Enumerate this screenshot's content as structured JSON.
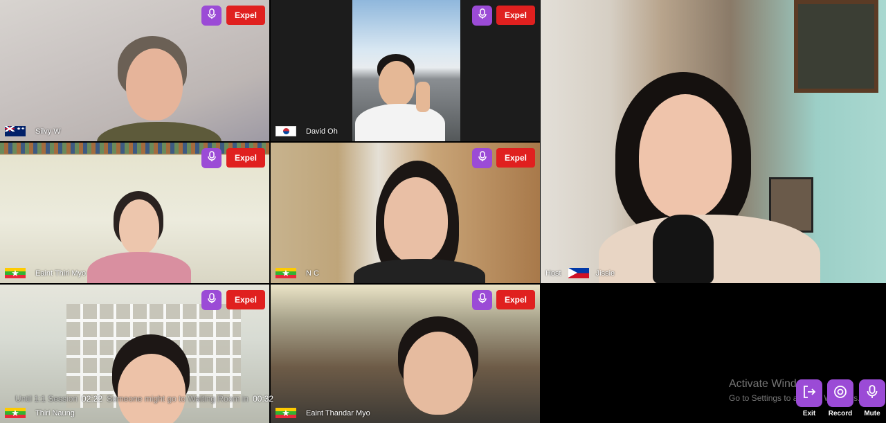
{
  "tiles": [
    {
      "name": "Silvy W",
      "flag": "australia-flag",
      "expel_label": "Expel"
    },
    {
      "name": "David Oh",
      "flag": "south-korea-flag",
      "expel_label": "Expel"
    },
    {
      "name": "Eaint Thiri Myo",
      "flag": "myanmar-flag",
      "expel_label": "Expel"
    },
    {
      "name": "N C",
      "flag": "myanmar-flag",
      "expel_label": "Expel"
    },
    {
      "name": "Thiri Naung",
      "flag": "myanmar-flag",
      "expel_label": "Expel"
    },
    {
      "name": "Eaint Thandar Myo",
      "flag": "myanmar-flag",
      "expel_label": "Expel"
    }
  ],
  "host": {
    "role_label": "Host",
    "name": "Jissie",
    "flag": "philippines-flag"
  },
  "timer": {
    "session_label": "Until 1:1 Session",
    "session_time": "02:22",
    "waiting_label": "Someone might go to Waiting Room in",
    "waiting_time": "00:32"
  },
  "watermark": {
    "title": "Activate Windows",
    "subtitle": "Go to Settings to activate Windows."
  },
  "controls": {
    "exit_label": "Exit",
    "record_label": "Record",
    "mute_label": "Mute"
  },
  "colors": {
    "accent_purple": "#9b4bd6",
    "expel_red": "#e0201f"
  }
}
